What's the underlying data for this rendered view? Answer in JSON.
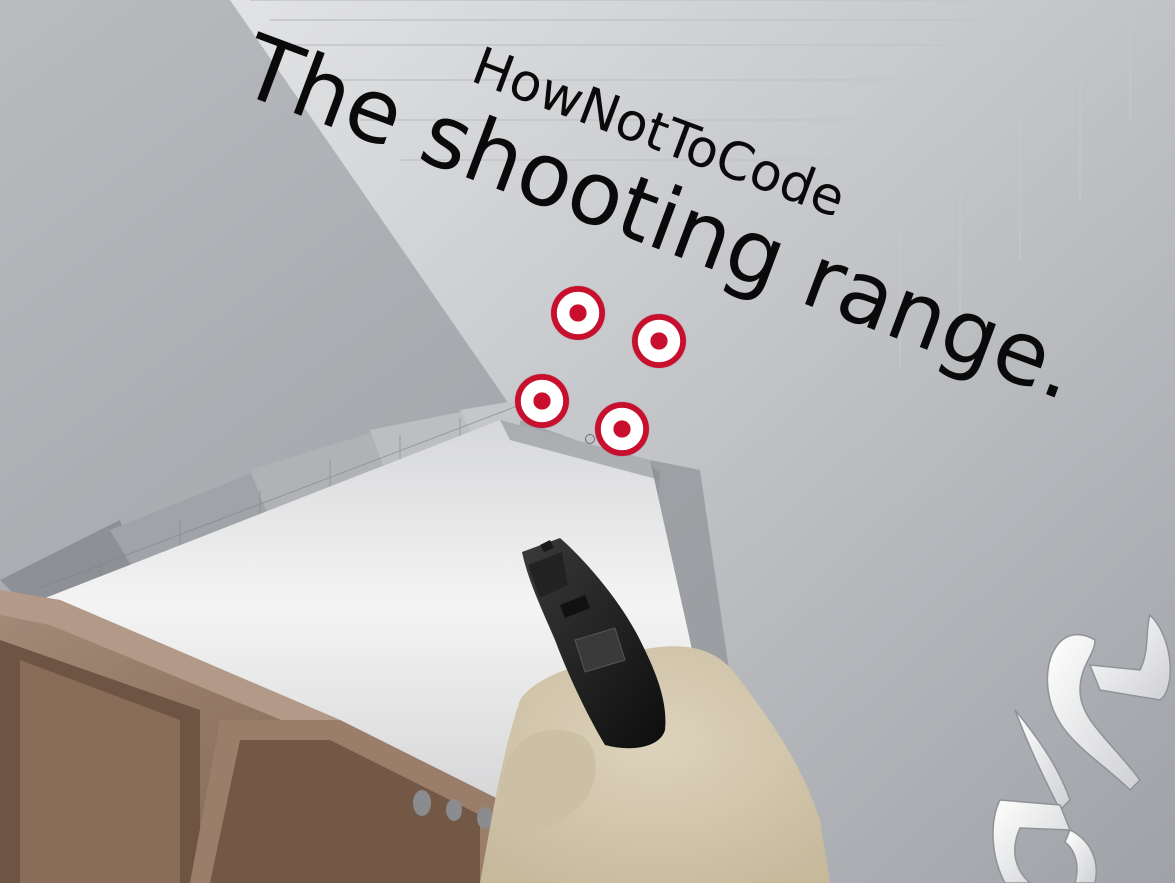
{
  "game": {
    "subtitle": "HowNotToCode",
    "title": "The shooting range."
  },
  "hud": {
    "targets_remaining": 4,
    "ammo_slots": 3
  },
  "icons": {
    "logo": "hownottocode-logo-icon",
    "weapon": "pistol-icon",
    "crosshair": "crosshair-icon"
  },
  "colors": {
    "target_red": "#c8102e",
    "wall_grey": "#a3a6ab",
    "floor_white": "#eeeeee",
    "glove_tan": "#d7cbb0",
    "cabinet_brown": "#8b6e5a"
  }
}
